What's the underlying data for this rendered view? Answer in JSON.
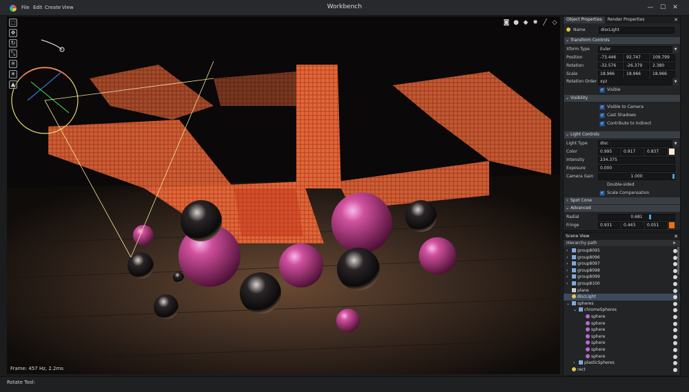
{
  "window": {
    "title": "Workbench",
    "menus": [
      "File",
      "Edit",
      "Create",
      "View"
    ],
    "controls": {
      "minimize": "—",
      "maximize": "☐",
      "close": "✕"
    }
  },
  "viewport": {
    "frame_info": "Frame:  457 Hz,  2.2ms",
    "tool_icons": [
      "select-icon",
      "move-icon",
      "rotate-icon",
      "scale-icon",
      "transform-icon",
      "light-gizmo-icon",
      "camera-gizmo-icon"
    ],
    "view_icons": [
      "camera-icon",
      "shading-solid-icon",
      "shading-sphere-icon",
      "wireframe-icon",
      "grid-icon"
    ]
  },
  "statusbar": {
    "text": "Rotate Tool:"
  },
  "properties": {
    "tabs": [
      "Object Properties",
      "Render Properties"
    ],
    "name_label": "Name",
    "name_value": "discLight",
    "transform": {
      "section": "Transform Controls",
      "xform_type_label": "Xform Type",
      "xform_type_value": "Euler",
      "position_label": "Position",
      "position": [
        "-73.446",
        "92.747",
        "109.799"
      ],
      "rotation_label": "Rotation",
      "rotation": [
        "-32.576",
        "-26.379",
        "2.380"
      ],
      "scale_label": "Scale",
      "scale": [
        "18.966",
        "18.966",
        "18.966"
      ],
      "rotation_order_label": "Rotation Order",
      "rotation_order_value": "xyz",
      "visible_label": "Visible"
    },
    "visibility": {
      "section": "Visibility",
      "visible_to_camera": "Visible to Camera",
      "cast_shadows": "Cast Shadows",
      "contribute_to_indirect": "Contribute to Indirect"
    },
    "light": {
      "section": "Light Controls",
      "light_type_label": "Light Type",
      "light_type_value": "disc",
      "color_label": "Color",
      "color": [
        "0.995",
        "0.917",
        "0.837"
      ],
      "color_swatch": "#fde9d5",
      "intensity_label": "Intensity",
      "intensity_value": "234.375",
      "exposure_label": "Exposure",
      "exposure_value": "0.000",
      "camera_gain_label": "Camera Gain",
      "camera_gain_value": "1.000",
      "double_sided": "Double-sided",
      "scale_compensation": "Scale Compensation"
    },
    "spot_cone": {
      "section": "Spot Cone"
    },
    "advanced": {
      "section": "Advanced",
      "radial_label": "Radial",
      "radial_value": "0.681",
      "fringe_label": "Fringe",
      "fringe": [
        "0.931",
        "0.443",
        "0.051"
      ],
      "fringe_swatch": "#ed7112"
    }
  },
  "scene": {
    "title": "Scene View",
    "hierarchy_label": "Hierarchy path",
    "items": [
      {
        "label": "group8095",
        "depth": 0,
        "type": "group",
        "expander": "›"
      },
      {
        "label": "group8096",
        "depth": 0,
        "type": "group",
        "expander": "›"
      },
      {
        "label": "group8097",
        "depth": 0,
        "type": "group",
        "expander": "›"
      },
      {
        "label": "group8098",
        "depth": 0,
        "type": "group",
        "expander": "›"
      },
      {
        "label": "group8099",
        "depth": 0,
        "type": "group",
        "expander": "›"
      },
      {
        "label": "group8100",
        "depth": 0,
        "type": "group",
        "expander": "›"
      },
      {
        "label": "plane",
        "depth": 0,
        "type": "mesh",
        "expander": ""
      },
      {
        "label": "discLight",
        "depth": 0,
        "type": "light",
        "expander": "",
        "selected": true
      },
      {
        "label": "spheres",
        "depth": 0,
        "type": "group",
        "expander": "⌄"
      },
      {
        "label": "chromeSpheres",
        "depth": 1,
        "type": "group",
        "expander": "⌄"
      },
      {
        "label": "sphere",
        "depth": 2,
        "type": "sphere",
        "expander": ""
      },
      {
        "label": "sphere",
        "depth": 2,
        "type": "sphere",
        "expander": ""
      },
      {
        "label": "sphere",
        "depth": 2,
        "type": "sphere",
        "expander": ""
      },
      {
        "label": "sphere",
        "depth": 2,
        "type": "sphere",
        "expander": ""
      },
      {
        "label": "sphere",
        "depth": 2,
        "type": "sphere",
        "expander": ""
      },
      {
        "label": "sphere",
        "depth": 2,
        "type": "sphere",
        "expander": ""
      },
      {
        "label": "sphere",
        "depth": 2,
        "type": "sphere",
        "expander": ""
      },
      {
        "label": "plasticSpheres",
        "depth": 1,
        "type": "group",
        "expander": "›"
      },
      {
        "label": "rect",
        "depth": 0,
        "type": "light",
        "expander": ""
      }
    ]
  }
}
